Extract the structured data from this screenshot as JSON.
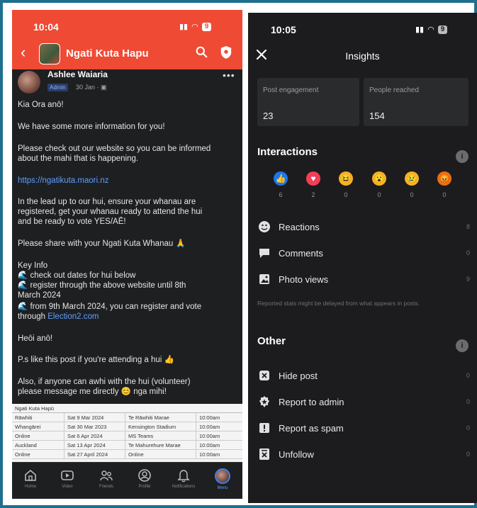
{
  "left": {
    "status_time": "10:04",
    "battery": "9",
    "group_title": "Ngati Kuta Hapu",
    "author_name": "Ashlee Waiaria",
    "admin_badge": "Admin",
    "post_meta": "30 Jan · ",
    "post_lines": [
      "Kia Ora anō!",
      "We have some more information for you!",
      "Please check out our website so you can be informed",
      "about the mahi that is happening.",
      "https://ngatikuta.maori.nz",
      "In the lead up to our hui, ensure your whanau are",
      "registered, get your whanau ready to attend the hui",
      "and be ready to vote YES/AĒ!",
      "Please share with your Ngati Kuta Whanau 🙏",
      "Key Info",
      "🌊 check out dates for hui below",
      "🌊 register through the above website until 8th",
      "March 2024",
      "🌊 from 9th March 2024, you can register and vote",
      "through ",
      "Election2.com",
      "Heōi anō!",
      "P.s like this post if you're attending a hui 👍",
      "Also, if anyone can awhi with the hui (volunteer)",
      "please message me directly 😊 nga mihi!"
    ],
    "table_title": "Ngati Kuta Hapū",
    "table_rows": [
      [
        "Rāwhiti",
        "Sat 9 Mar 2024",
        "Te Rāwhiti Marae",
        "10:00am"
      ],
      [
        "Whangārei",
        "Sat 30 Mar 2023",
        "Kensington Stadium",
        "10:00am"
      ],
      [
        "Online",
        "Sat 6 Apr 2024",
        "MS Teams",
        "10:00am"
      ],
      [
        "Auckland",
        "Sat 13 Apr 2024",
        "Te Mahurehure Marae",
        "10:00am"
      ],
      [
        "Online",
        "Sat 27 April 2024",
        "Online",
        "10:00am"
      ]
    ],
    "tabs": [
      "Home",
      "Video",
      "Friends",
      "Profile",
      "Notifications",
      "Menu"
    ]
  },
  "right": {
    "status_time": "10:05",
    "battery": "9",
    "title": "Insights",
    "post_engagement_label": "Post engagement",
    "post_engagement_value": "23",
    "people_reached_label": "People reached",
    "people_reached_value": "154",
    "interactions_title": "Interactions",
    "reactions": [
      {
        "icon": "like-icon",
        "color": "#1877f2",
        "count": "6"
      },
      {
        "icon": "love-icon",
        "color": "#f33e58",
        "count": "2"
      },
      {
        "icon": "haha-icon",
        "color": "#f7b125",
        "count": "0"
      },
      {
        "icon": "wow-icon",
        "color": "#f7b125",
        "count": "0"
      },
      {
        "icon": "sad-icon",
        "color": "#f7b125",
        "count": "0"
      },
      {
        "icon": "angry-icon",
        "color": "#e9710f",
        "count": "0"
      }
    ],
    "interaction_rows": [
      {
        "label": "Reactions",
        "value": "8"
      },
      {
        "label": "Comments",
        "value": "0"
      },
      {
        "label": "Photo views",
        "value": "9"
      }
    ],
    "note": "Reported stats might be delayed from what appears in posts.",
    "other_title": "Other",
    "other_rows": [
      {
        "label": "Hide post",
        "value": "0"
      },
      {
        "label": "Report to admin",
        "value": "0"
      },
      {
        "label": "Report as spam",
        "value": "0"
      },
      {
        "label": "Unfollow",
        "value": "0"
      }
    ]
  }
}
